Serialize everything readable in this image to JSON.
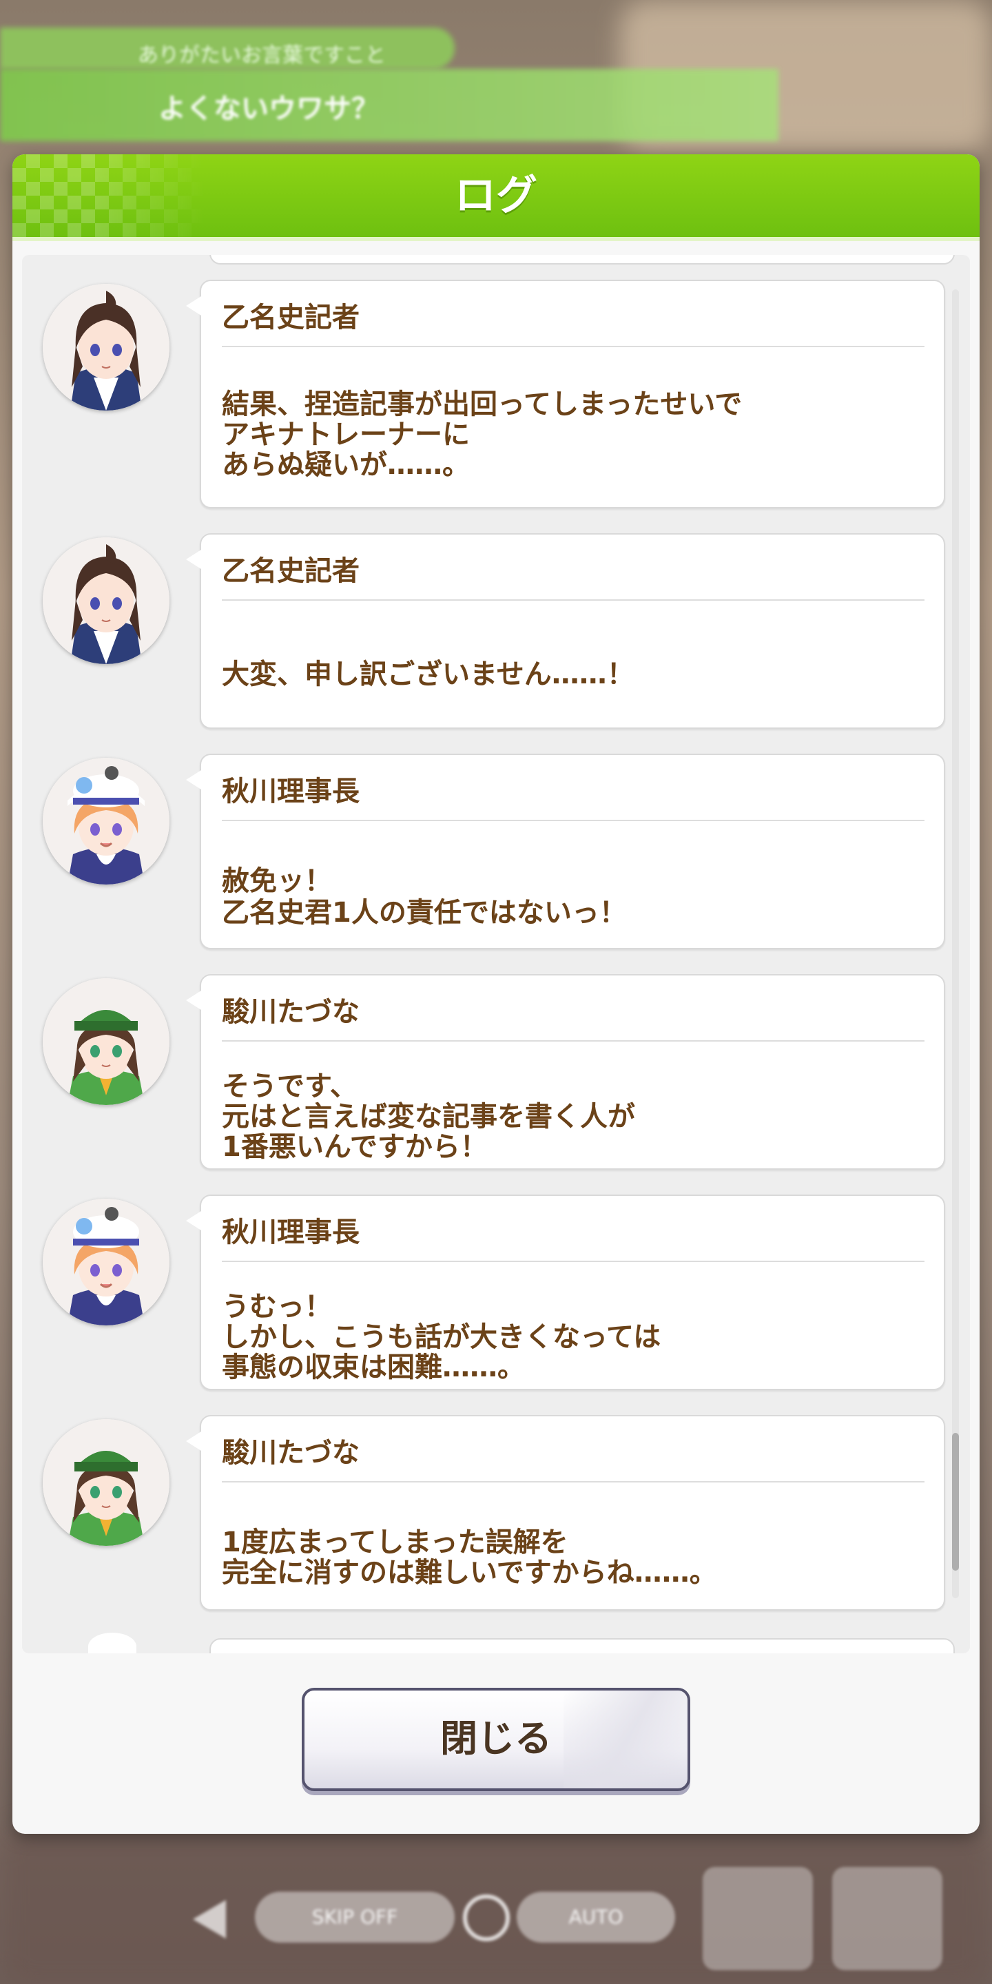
{
  "modal": {
    "title": "ログ",
    "close_label": "閉じる"
  },
  "background": {
    "banner_small": "ありがたいお言葉ですこと",
    "banner_main": "よくないウワサ？",
    "hud_skip": "SKIP OFF",
    "hud_auto": "AUTO"
  },
  "log": [
    {
      "speaker": "乙名史記者",
      "avatar": "otonashi-avatar",
      "lines": [
        "結果、捏造記事が出回ってしまったせいで",
        "アキナトレーナーに",
        "あらぬ疑いが……。"
      ]
    },
    {
      "speaker": "乙名史記者",
      "avatar": "otonashi-avatar",
      "lines": [
        "大変、申し訳ございません……！"
      ]
    },
    {
      "speaker": "秋川理事長",
      "avatar": "akikawa-avatar",
      "lines": [
        "赦免ッ！",
        "乙名史君1人の責任ではないっ！"
      ]
    },
    {
      "speaker": "駿川たづな",
      "avatar": "hayakawa-avatar",
      "lines": [
        "そうです、",
        "元はと言えば変な記事を書く人が",
        "1番悪いんですから！"
      ]
    },
    {
      "speaker": "秋川理事長",
      "avatar": "akikawa-avatar",
      "lines": [
        "うむっ！",
        "しかし、こうも話が大きくなっては",
        "事態の収束は困難……。"
      ]
    },
    {
      "speaker": "駿川たづな",
      "avatar": "hayakawa-avatar",
      "lines": [
        "1度広まってしまった誤解を",
        "完全に消すのは難しいですからね……。"
      ]
    }
  ],
  "colors": {
    "header_green": "#7cc812",
    "text_brown": "#6b4218",
    "button_border": "#55536e"
  }
}
